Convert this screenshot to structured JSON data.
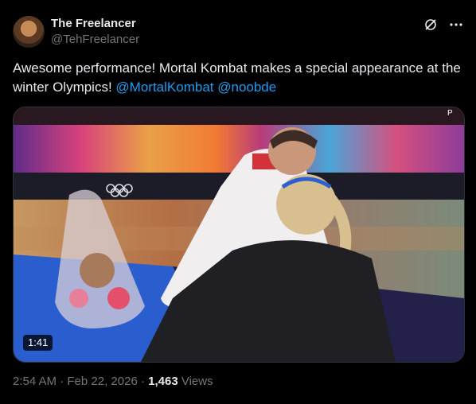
{
  "author": {
    "name": "The Freelancer",
    "handle": "@TehFreelancer"
  },
  "tweet": {
    "text_main": "Awesome performance! Mortal Kombat makes a special appearance at the winter Olympics! ",
    "mentions": [
      "@MortalKombat",
      "@noobde"
    ]
  },
  "media": {
    "duration": "1:41",
    "overlay_text": "P"
  },
  "meta": {
    "time": "2:54 AM",
    "separator": "·",
    "date": "Feb 22, 2026",
    "views_count": "1,463",
    "views_label": "Views"
  },
  "icons": {
    "grok": "grok-icon",
    "more": "more-icon"
  },
  "colors": {
    "background": "#000000",
    "text": "#e7e9ea",
    "secondary": "#71767b",
    "link": "#1d9bf0"
  }
}
